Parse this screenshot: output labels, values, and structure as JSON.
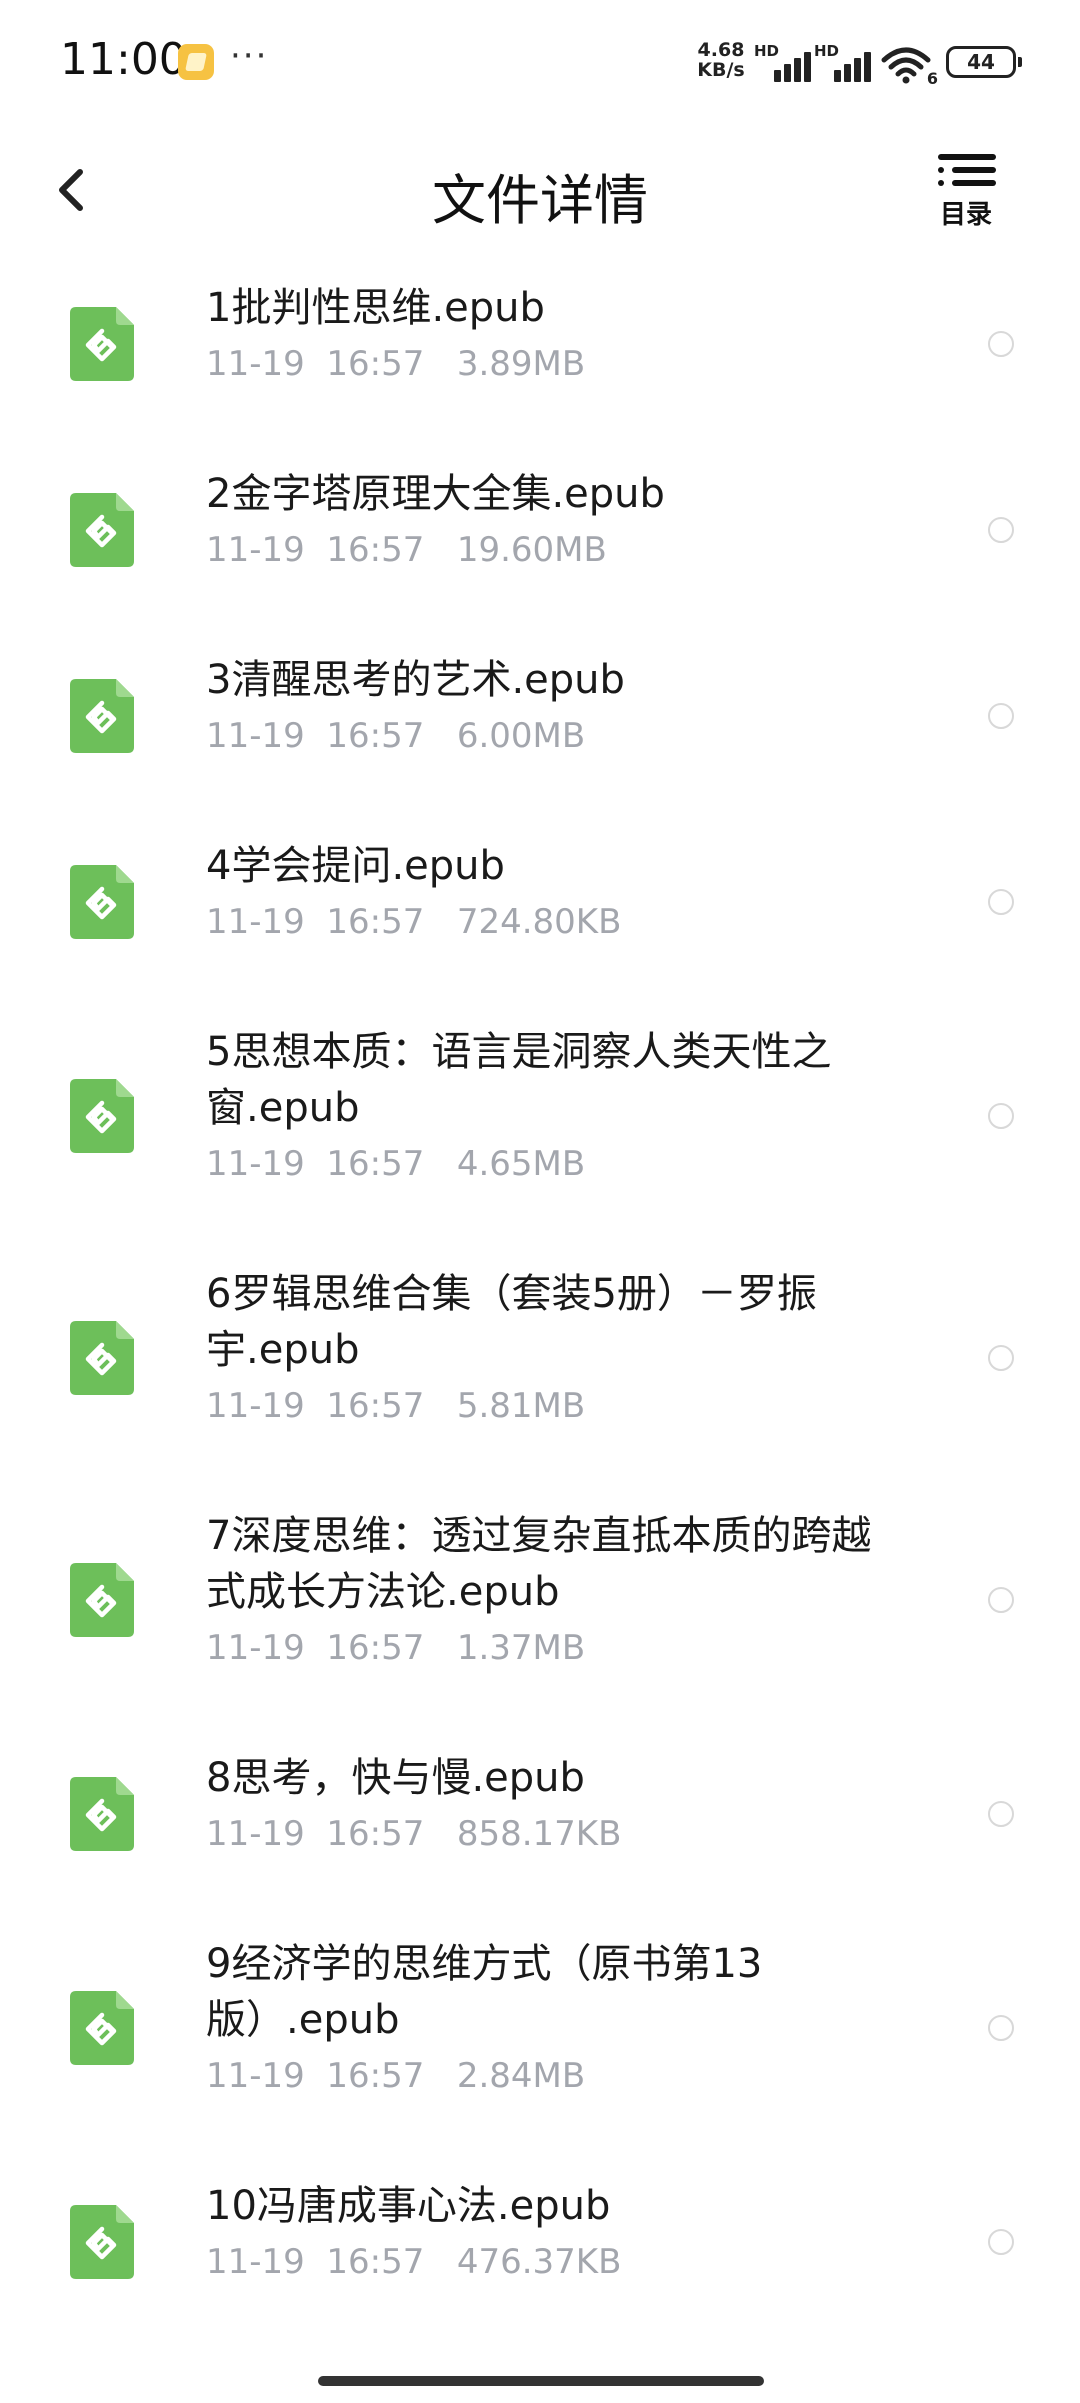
{
  "status_bar": {
    "time": "11:00",
    "net_speed_value": "4.68",
    "net_speed_unit": "KB/s",
    "sim1_label": "HD",
    "sim2_label": "HD",
    "wifi_label": "6",
    "battery": "44"
  },
  "header": {
    "title": "文件详情",
    "toc_label": "目录"
  },
  "files": [
    {
      "name": "1批判性思维.epub",
      "meta": "11-19  16:57   3.89MB"
    },
    {
      "name": "2金字塔原理大全集.epub",
      "meta": "11-19  16:57   19.60MB"
    },
    {
      "name": "3清醒思考的艺术.epub",
      "meta": "11-19  16:57   6.00MB"
    },
    {
      "name": "4学会提问.epub",
      "meta": "11-19  16:57   724.80KB"
    },
    {
      "name": "5思想本质：语言是洞察人类天性之窗.epub",
      "meta": "11-19  16:57   4.65MB"
    },
    {
      "name": "6罗辑思维合集（套装5册）－罗振宇.epub",
      "meta": "11-19  16:57   5.81MB"
    },
    {
      "name": "7深度思维：透过复杂直抵本质的跨越式成长方法论.epub",
      "meta": "11-19  16:57   1.37MB"
    },
    {
      "name": "8思考，快与慢.epub",
      "meta": "11-19  16:57   858.17KB"
    },
    {
      "name": "9经济学的思维方式（原书第13版）.epub",
      "meta": "11-19  16:57   2.84MB"
    },
    {
      "name": "10冯唐成事心法.epub",
      "meta": "11-19  16:57   476.37KB"
    }
  ],
  "icons": {
    "file_icon": "epub-file-icon",
    "file_icon_color": "#6dbf5a",
    "back": "chevron-left-icon",
    "toc": "list-icon"
  }
}
